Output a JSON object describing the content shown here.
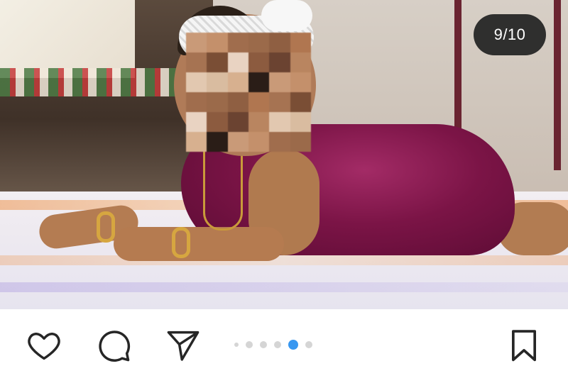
{
  "post": {
    "counter": "9/10",
    "carousel": {
      "current": 9,
      "total": 10,
      "visible_dots": 6,
      "active_dot_index": 4
    }
  },
  "colors": {
    "accent": "#3897f0",
    "icon": "#262626",
    "counter_bg": "#262626",
    "dot_inactive": "#d5d5d5"
  },
  "icons": {
    "like": "heart-outline",
    "comment": "speech-bubble-outline",
    "share": "paper-plane-outline",
    "save": "bookmark-outline"
  }
}
